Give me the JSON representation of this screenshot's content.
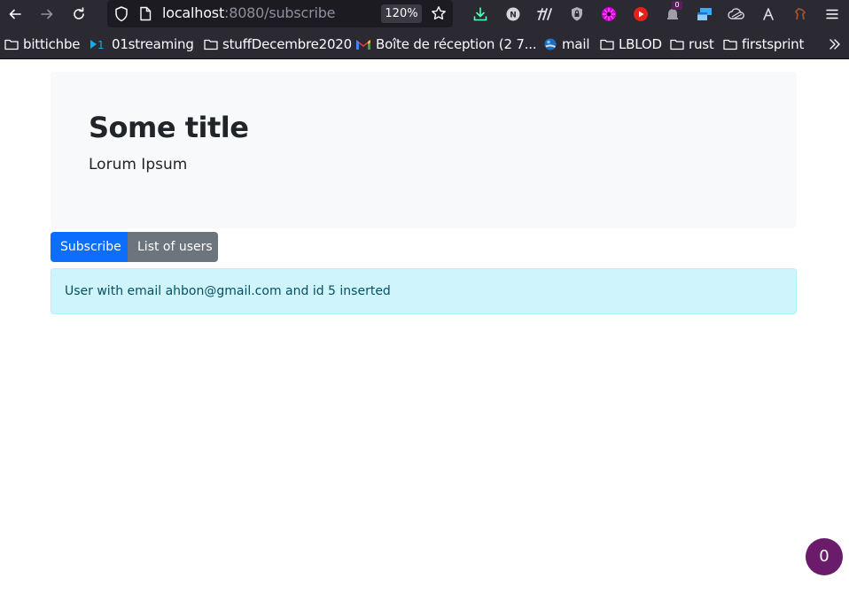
{
  "browser": {
    "url_host": "localhost",
    "url_rest": ":8080/subscribe",
    "zoom": "120%",
    "extension_badge": "0"
  },
  "bookmarks": [
    {
      "label": "bittichbe",
      "icon": "folder-icon"
    },
    {
      "label": "01streaming",
      "icon": "streaming-icon"
    },
    {
      "label": "stuffDecembre2020",
      "icon": "folder-icon"
    },
    {
      "label": "Boîte de réception (2 7...",
      "icon": "gmail-icon"
    },
    {
      "label": "mail",
      "icon": "mail-globe-icon"
    },
    {
      "label": "LBLOD",
      "icon": "folder-icon"
    },
    {
      "label": "rust",
      "icon": "folder-icon"
    },
    {
      "label": "firstsprint",
      "icon": "folder-icon"
    }
  ],
  "jumbotron": {
    "title": "Some title",
    "lead": "Lorum Ipsum"
  },
  "buttons": {
    "subscribe": "Subscribe",
    "list_users": "List of users"
  },
  "alert": {
    "message": "User with email ahbon@gmail.com and id 5 inserted"
  },
  "fab": {
    "label": "0"
  },
  "colors": {
    "primary": "#0d6efd",
    "secondary": "#6c757d",
    "alert_bg": "#cff4fc",
    "alert_text": "#055160",
    "fab": "#6a1b6a",
    "chrome": "#2b2a33"
  }
}
